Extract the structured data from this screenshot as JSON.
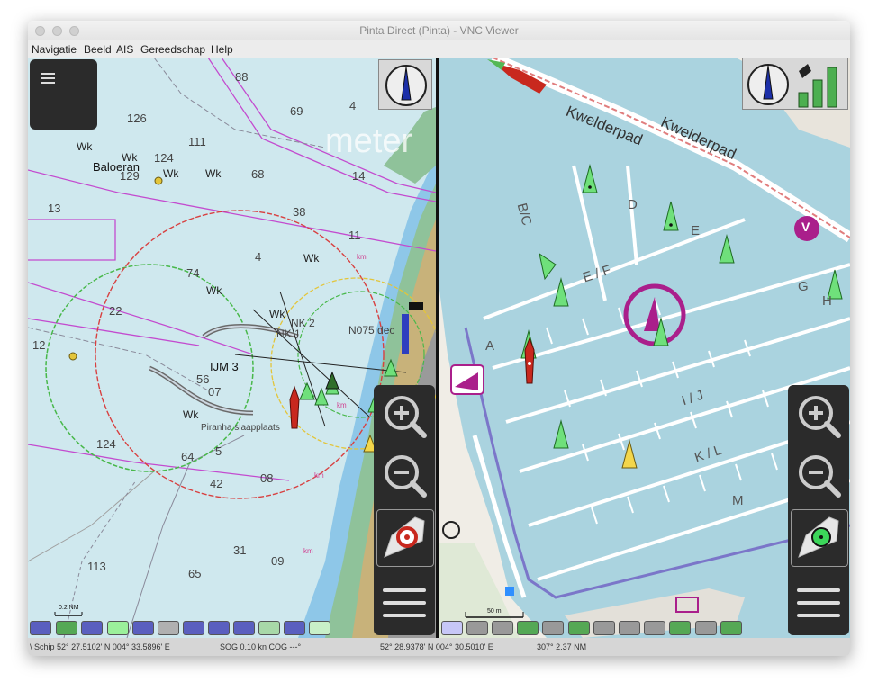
{
  "window": {
    "title": "Pinta Direct (Pinta) - VNC Viewer"
  },
  "menu": [
    "Navigatie",
    "Beeld",
    "AIS",
    "Gereedschap",
    "Help"
  ],
  "left_map": {
    "depth_soundings": [
      "88",
      "126",
      "69",
      "4",
      "111",
      "124",
      "129",
      "68",
      "14",
      "13",
      "38",
      "11",
      "4",
      "74",
      "22",
      "12",
      "56",
      "07",
      "124",
      "64",
      "5",
      "42",
      "08",
      "31",
      "09",
      "113",
      "65"
    ],
    "labels": {
      "wk": "Wk",
      "baloeran": "Baloeran",
      "ijm3": "IJM 3",
      "piranha": "Piranha slaapplaats",
      "meter": "meter",
      "nk1": "NK 1",
      "nk2": "NK 2",
      "n75": "N075 dec",
      "km": "km",
      "scale": "0.2 NM"
    }
  },
  "right_map": {
    "streets": [
      "Kwelderpad",
      "Kwelderpad"
    ],
    "pier_labels": [
      "B/C",
      "D",
      "E",
      "E / F",
      "A",
      "G",
      "H",
      "I / J",
      "K / L",
      "M"
    ],
    "scale": "50 m",
    "poi_v": "V"
  },
  "buttons": {
    "left": [
      "zoom-in",
      "zoom-out",
      "center-boat",
      "menu"
    ],
    "right": [
      "zoom-in",
      "zoom-out",
      "center-boat",
      "menu"
    ]
  },
  "status": {
    "left_pos": "\\ Schip 52° 27.5102' N   004° 33.5896' E",
    "sog": "SOG 0.10 kn  COG ---°",
    "right_pos": "52° 28.9378' N   004° 30.5010' E",
    "bearing": "307°  2.37 NM"
  },
  "colors": {
    "chart_water": "#cfe8ee",
    "shallow": "#8ec7e8",
    "land": "#c8b27a",
    "green_area": "#8fc29a",
    "osm_water": "#aad3df",
    "harbour_poi": "#aa1f8b",
    "ais_green": "#6fe07b",
    "ais_yellow": "#f3d64b",
    "own_ship": "#c8281e"
  },
  "layer_chips_left": [
    "#5a5fbf",
    "#55a855",
    "#5a5fbf",
    "#9bf09b",
    "#5a5fbf",
    "#b0b0b0",
    "#5a5fbf",
    "#5a5fbf",
    "#5a5fbf",
    "#a8d8a8",
    "#5a5fbf",
    "#c8f0c8"
  ],
  "layer_chips_right": [
    "#c7c7f7",
    "#999999",
    "#999999",
    "#55a855",
    "#999999",
    "#55a855",
    "#999999",
    "#999999",
    "#999999",
    "#55a855",
    "#999999",
    "#55a855"
  ]
}
